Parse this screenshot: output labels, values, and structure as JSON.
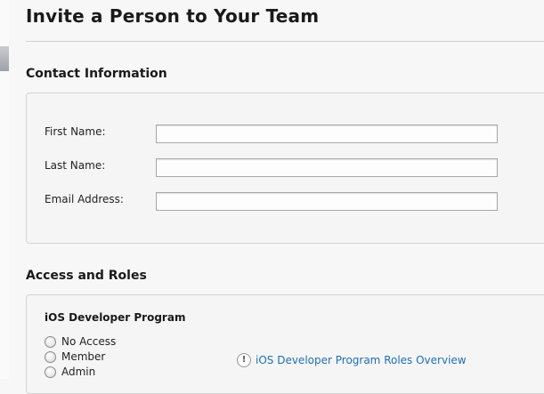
{
  "page": {
    "title": "Invite a Person to Your Team"
  },
  "contact": {
    "heading": "Contact Information",
    "fields": [
      {
        "label": "First Name:",
        "value": ""
      },
      {
        "label": "Last Name:",
        "value": ""
      },
      {
        "label": "Email Address:",
        "value": ""
      }
    ]
  },
  "access": {
    "heading": "Access and Roles",
    "program": "iOS Developer Program",
    "options": [
      "No Access",
      "Member",
      "Admin"
    ],
    "link_icon": "info-icon",
    "link_text": "iOS Developer Program Roles Overview"
  },
  "colors": {
    "link": "#1f6fb2",
    "background": "#f7f7f7",
    "panel_border": "#d3d3d3"
  }
}
